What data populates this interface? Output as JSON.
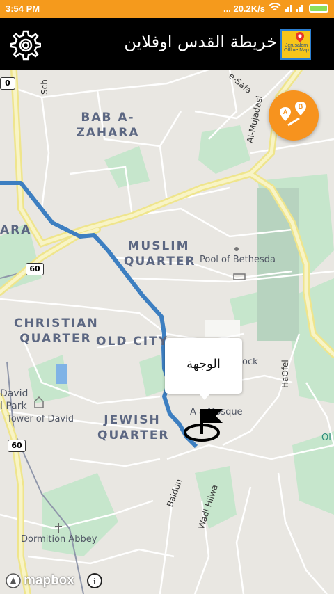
{
  "status_bar": {
    "time": "3:54 PM",
    "speed": "... 20.2K/s"
  },
  "app_bar": {
    "title": "خريطة القدس اوفلاين",
    "logo_text": "Jerusalem Offline Map"
  },
  "map": {
    "districts": [
      {
        "id": "bab-a-zahara",
        "line1": "BAB A-",
        "line2": "ZAHARA"
      },
      {
        "id": "muslim-quarter",
        "line1": "MUSLIM",
        "line2": "QUARTER"
      },
      {
        "id": "christian-quarter",
        "line1": "CHRISTIAN",
        "line2": "QUARTER"
      },
      {
        "id": "jewish-quarter",
        "line1": "JEWISH",
        "line2": "QUARTER"
      },
      {
        "id": "old-city",
        "line1": "OLD CITY",
        "line2": ""
      },
      {
        "id": "ara",
        "line1": "ARA",
        "line2": ""
      }
    ],
    "pois": {
      "pool": "Pool of Bethesda",
      "mosque": "A      a Mosque",
      "rock": "ock",
      "tower": "Tower of David",
      "david": "David",
      "park": "l Park",
      "abbey": "Dormition Abbey",
      "ol": "Ol"
    },
    "streets": {
      "al_mujadasi": "Al-Mujadasi",
      "safa": "e-Safa",
      "schi": "Sch",
      "haofel": "HaOfel",
      "baidun": "Baidun",
      "wadi_hilwa": "Wadi Hilwa"
    },
    "road_shields": {
      "shield_60a": "60",
      "shield_60b": "60",
      "shield_top": "0"
    },
    "destination_label": "الوجهة",
    "attribution": "mapbox",
    "info": "i"
  },
  "colors": {
    "accent": "#f7931e",
    "route": "#3d7fc1",
    "road_major": "#f4ee9a",
    "park": "#c2e7c9"
  },
  "icons": [
    "settings-icon",
    "route-ab-icon",
    "destination-flag-icon",
    "mapbox-logo-icon",
    "info-icon"
  ]
}
